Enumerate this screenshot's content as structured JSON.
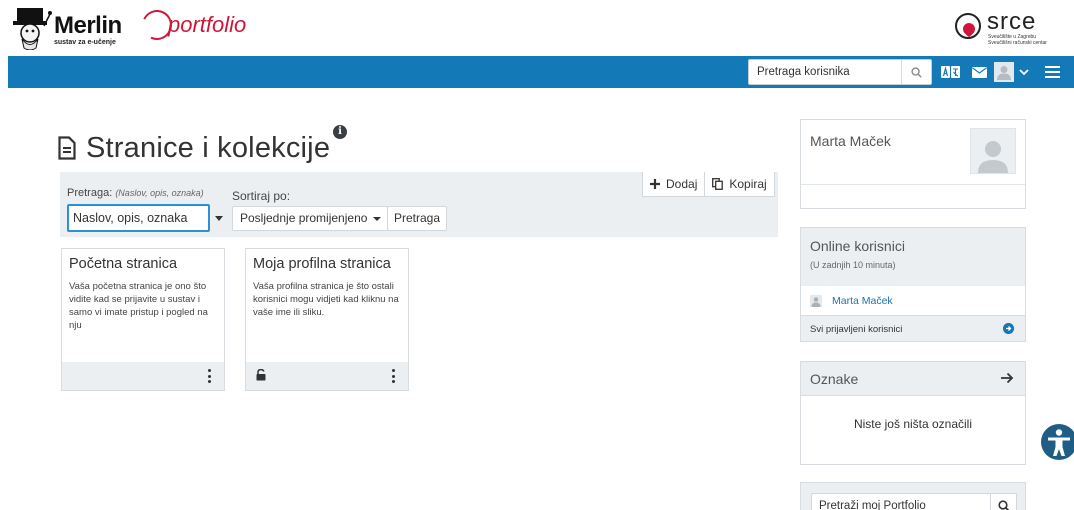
{
  "header": {
    "merlin_title": "Merlin",
    "merlin_subtitle": "sustav za e-učenje",
    "portfolio_title": "portfolio",
    "srce_title": "srce",
    "srce_subtitle": "Sveučilište u Zagrebu Sveučilišni računski centar"
  },
  "navbar": {
    "user_search_placeholder": "Pretraga korisnika",
    "icons": [
      "search-icon",
      "language-icon",
      "mail-icon",
      "user-avatar-icon",
      "chevron-down-icon",
      "menu-icon"
    ],
    "accent_color": "#1379b7"
  },
  "page": {
    "title": "Stranice i kolekcije"
  },
  "filters": {
    "search_label": "Pretraga:",
    "search_hint": "(Naslov, opis, oznaka)",
    "search_placeholder": "Naslov, opis, oznaka",
    "sort_label": "Sortiraj po:",
    "sort_value": "Posljednje promijenjeno",
    "search_button": "Pretraga",
    "add_button": "Dodaj",
    "copy_button": "Kopiraj"
  },
  "cards": [
    {
      "title": "Početna stranica",
      "description": "Vaša početna stranica je ono što vidite kad se prijavite u sustav i samo vi imate pristup i pogled na nju",
      "locked": false
    },
    {
      "title": "Moja profilna stranica",
      "description": "Vaša profilna stranica je što ostali korisnici mogu vidjeti kad kliknu na vaše ime ili sliku.",
      "locked": true
    }
  ],
  "sidebar": {
    "user_name": "Marta Maček",
    "online": {
      "title": "Online korisnici",
      "subtitle": "(U zadnjih 10 minuta)",
      "users": [
        "Marta Maček"
      ],
      "all_link": "Svi prijavljeni korisnici"
    },
    "tags": {
      "title": "Oznake",
      "empty_text": "Niste još ništa označili"
    },
    "portfolio_search_placeholder": "Pretraži moj Portfolio"
  }
}
